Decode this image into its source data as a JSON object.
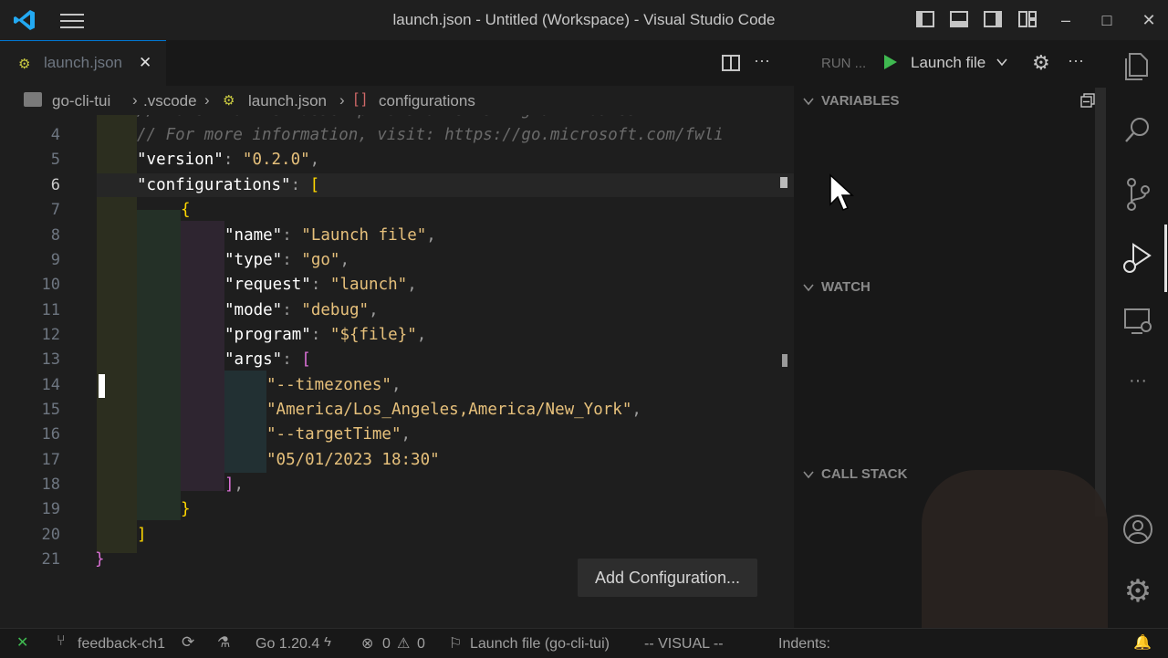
{
  "window": {
    "title": "launch.json - Untitled (Workspace) - Visual Studio Code"
  },
  "tab": {
    "label": "launch.json",
    "close": "✕"
  },
  "breadcrumb": {
    "items": [
      "go-cli-tui",
      ".vscode",
      "launch.json",
      "configurations"
    ]
  },
  "editor": {
    "line_numbers": [
      "4",
      "5",
      "6",
      "7",
      "8",
      "9",
      "10",
      "11",
      "12",
      "13",
      "14",
      "15",
      "16",
      "17",
      "18",
      "19",
      "20",
      "21"
    ],
    "lines": {
      "l4": "// For more information, visit: https://go.microsoft.com/fwli",
      "l5k": "\"version\"",
      "l5v": "\"0.2.0\"",
      "l6k": "\"configurations\"",
      "l8k": "\"name\"",
      "l8v": "\"Launch file\"",
      "l9k": "\"type\"",
      "l9v": "\"go\"",
      "l10k": "\"request\"",
      "l10v": "\"launch\"",
      "l11k": "\"mode\"",
      "l11v": "\"debug\"",
      "l12k": "\"program\"",
      "l12v": "\"${file}\"",
      "l13k": "\"args\"",
      "l14v": "\"--timezones\"",
      "l15v": "\"America/Los_Angeles,America/New_York\"",
      "l16v": "\"--targetTime\"",
      "l17v": "\"05/01/2023 18:30\""
    },
    "add_config_label": "Add Configuration..."
  },
  "debug": {
    "run_label": "RUN ...",
    "launch_config": "Launch file",
    "sections": {
      "variables": "VARIABLES",
      "watch": "WATCH",
      "call_stack": "CALL STACK"
    }
  },
  "status": {
    "branch": "feedback-ch1",
    "go_version": "Go 1.20.4",
    "errors": "0",
    "warnings": "0",
    "launch": "Launch file (go-cli-tui)",
    "mode": "-- VISUAL --",
    "indents": "Indents:"
  }
}
